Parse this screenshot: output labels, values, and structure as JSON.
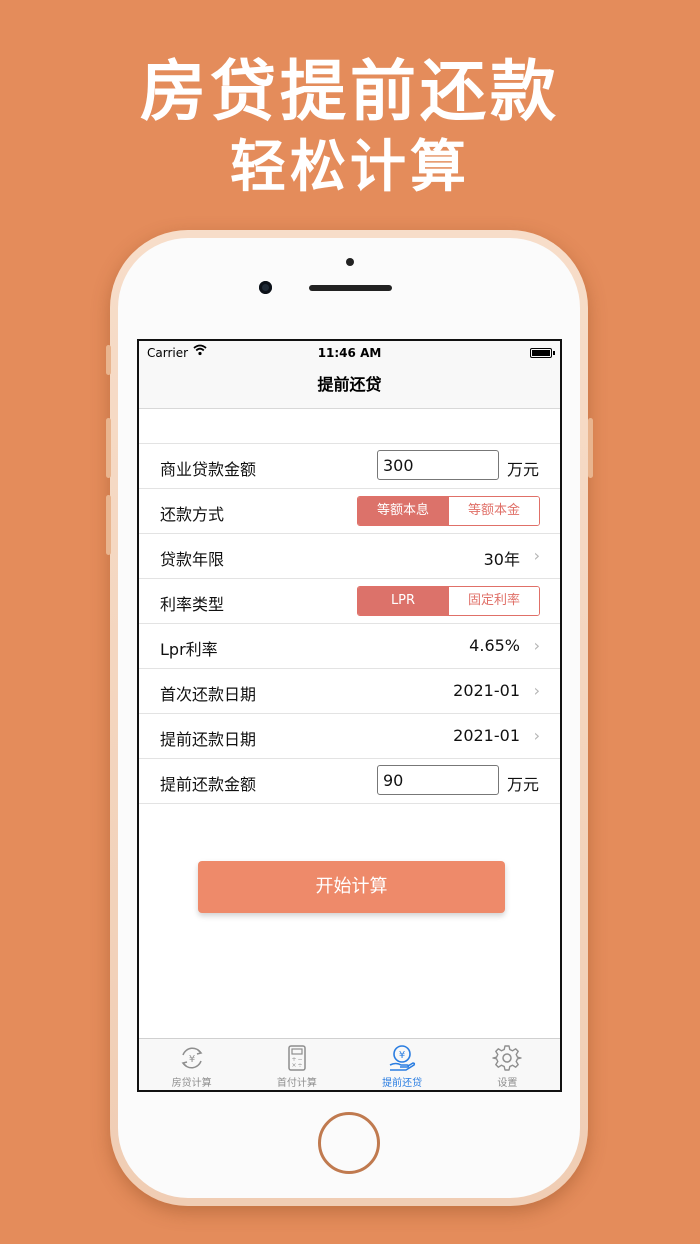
{
  "headline": {
    "line1": "房贷提前还款",
    "line2": "轻松计算"
  },
  "status": {
    "carrier": "Carrier",
    "time": "11:46 AM"
  },
  "nav": {
    "title": "提前还贷"
  },
  "form": {
    "loan_amount": {
      "label": "商业贷款金额",
      "value": "300",
      "unit": "万元"
    },
    "repay_method": {
      "label": "还款方式",
      "options": [
        "等额本息",
        "等额本金"
      ],
      "selected": "等额本息"
    },
    "loan_term": {
      "label": "贷款年限",
      "value": "30年"
    },
    "rate_type": {
      "label": "利率类型",
      "options": [
        "LPR",
        "固定利率"
      ],
      "selected": "LPR"
    },
    "lpr_rate": {
      "label": "Lpr利率",
      "value": "4.65%"
    },
    "first_repay_date": {
      "label": "首次还款日期",
      "value": "2021-01"
    },
    "prepay_date": {
      "label": "提前还款日期",
      "value": "2021-01"
    },
    "prepay_amount": {
      "label": "提前还款金额",
      "value": "90",
      "unit": "万元"
    }
  },
  "calc_button": {
    "label": "开始计算"
  },
  "tabs": [
    {
      "label": "房贷计算",
      "icon": "yuan-refresh-icon",
      "active": false
    },
    {
      "label": "首付计算",
      "icon": "calculator-icon",
      "active": false
    },
    {
      "label": "提前还贷",
      "icon": "yuan-hand-icon",
      "active": true
    },
    {
      "label": "设置",
      "icon": "gear-icon",
      "active": false
    }
  ],
  "colors": {
    "background": "#e48c5b",
    "accent": "#dc726a",
    "button": "#ee8a6a",
    "tab_active": "#2a7de1"
  }
}
